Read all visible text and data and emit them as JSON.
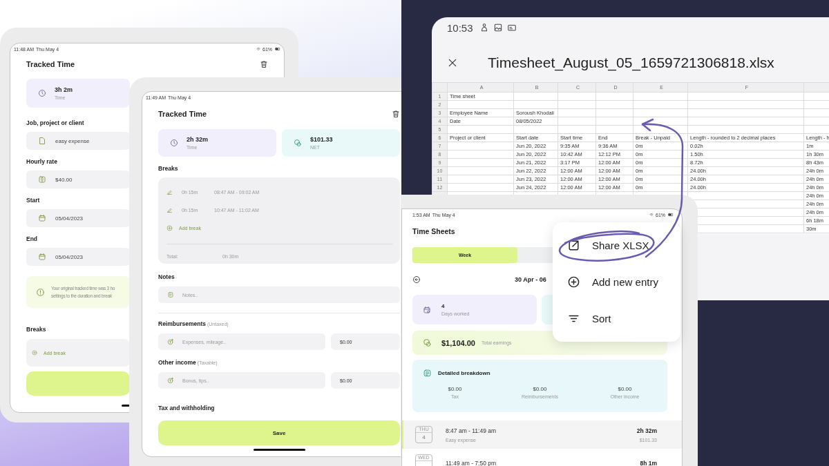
{
  "back_screen": {
    "status": {
      "time": "11:48 AM",
      "date": "Thu May 4",
      "battery": "61%"
    },
    "title": "Tracked Time",
    "time_card": {
      "value": "3h 2m",
      "label": "Time"
    },
    "fields": [
      {
        "label": "Job, project or client",
        "value": "easy expense",
        "kind": "project"
      },
      {
        "label": "Hourly rate",
        "value": "$40.00",
        "kind": "rate"
      },
      {
        "label": "Start",
        "value": "05/04/2023",
        "kind": "date"
      },
      {
        "label": "End",
        "value": "05/04/2023",
        "kind": "date"
      }
    ],
    "notice": [
      "Your original tracked time was 3 ho",
      "settings to the duration and break"
    ],
    "breaks_label": "Breaks",
    "add_break": "Add break"
  },
  "edit_screen": {
    "status": {
      "time": "11:49 AM",
      "date": "Thu May 4"
    },
    "title": "Tracked Time",
    "summary": [
      {
        "value": "2h 32m",
        "label": "Time",
        "kind": "time"
      },
      {
        "value": "$101.33",
        "label": "NET",
        "kind": "money"
      }
    ],
    "breaks_label": "Breaks",
    "breaks": [
      {
        "duration": "0h 15m",
        "range": "08:47 AM - 09:02 AM"
      },
      {
        "duration": "0h 15m",
        "range": "10:47 AM - 11:02 AM"
      }
    ],
    "add_break": "Add break",
    "total_label": "Total:",
    "total_value": "0h 30m",
    "notes_label": "Notes",
    "notes_placeholder": "Notes..",
    "extras": [
      {
        "label": "Reimbursements",
        "note": "(Untaxed)",
        "placeholder": "Expenses, mileage..",
        "amount": "$0.00"
      },
      {
        "label": "Other income",
        "note": "(Taxable)",
        "placeholder": "Bonus, tips..",
        "amount": "$0.00"
      }
    ],
    "tax_label": "Tax and withholding",
    "save": "Save"
  },
  "spreadsheet": {
    "status_time": "10:53",
    "title": "Timesheet_August_05_1659721306818.xlsx",
    "columns": [
      {
        "header": "A"
      },
      {
        "header": "B"
      },
      {
        "header": "C"
      },
      {
        "header": "D"
      },
      {
        "header": "E"
      },
      {
        "header": "F"
      },
      {}
    ],
    "rows": [
      {
        "number": "1",
        "cells": [
          "Time sheet"
        ]
      },
      {
        "number": "2"
      },
      {
        "number": "3",
        "cells": [
          "Employee Name",
          "Soroush Khodaii"
        ]
      },
      {
        "number": "4",
        "cells": [
          "Date",
          "08/05/2022"
        ]
      },
      {
        "number": "5"
      },
      {
        "number": "6",
        "cells": [
          "Project or client",
          "Start date",
          "Start time",
          "End",
          "Break - Unpaid",
          "Length - rounded to 2 decimal places",
          "Length - h"
        ]
      },
      {
        "number": "7",
        "cells": [
          null,
          "Jun 20, 2022",
          "9:35 AM",
          "9:36 AM",
          "0m",
          "0.02h",
          "1m"
        ]
      },
      {
        "number": "8",
        "cells": [
          null,
          "Jun 20, 2022",
          "10:42 AM",
          "12:12 PM",
          "0m",
          "1.50h",
          "1h 30m"
        ]
      },
      {
        "number": "9",
        "cells": [
          null,
          "Jun 21, 2022",
          "3:17 PM",
          "12:00 AM",
          "0m",
          "8.72h",
          "8h 43m"
        ]
      },
      {
        "number": "10",
        "cells": [
          null,
          "Jun 22, 2022",
          "12:00 AM",
          "12:00 AM",
          "0m",
          "24.00h",
          "24h 0m"
        ]
      },
      {
        "number": "11",
        "cells": [
          null,
          "Jun 23, 2022",
          "12:00 AM",
          "12:00 AM",
          "0m",
          "24.00h",
          "24h 0m"
        ]
      },
      {
        "number": "12",
        "cells": [
          null,
          "Jun 24, 2022",
          "12:00 AM",
          "12:00 AM",
          "0m",
          "24.00h",
          "24h 0m"
        ]
      },
      {
        "cells": [
          null,
          null,
          null,
          null,
          null,
          null,
          "24h 0m"
        ]
      },
      {
        "cells": [
          null,
          null,
          null,
          null,
          null,
          null,
          "24h 0m"
        ]
      },
      {
        "cells": [
          null,
          null,
          null,
          null,
          null,
          null,
          "24h 0m"
        ]
      },
      {
        "cells": [
          null,
          null,
          null,
          null,
          null,
          null,
          "6h 18m"
        ]
      },
      {
        "cells": [
          null,
          null,
          null,
          null,
          null,
          null,
          "30m"
        ]
      }
    ]
  },
  "time_sheets": {
    "status": {
      "time": "1:53 AM",
      "date": "Thu May 4",
      "battery": "61%"
    },
    "title": "Time Sheets",
    "segments": [
      {
        "label": "Week",
        "selected": true
      },
      {
        "selected": false
      }
    ],
    "date_range": "30 Apr - 06",
    "stats": [
      {
        "value": "4",
        "label": "Days worked",
        "kind": "days"
      },
      {
        "kind": "other"
      }
    ],
    "earnings": {
      "value": "$1,104.00",
      "label": "Total earnings"
    },
    "breakdown": {
      "title": "Detailed breakdown",
      "items": [
        {
          "value": "$0.00",
          "label": "Tax"
        },
        {
          "value": "$0.00",
          "label": "Reimbursements"
        },
        {
          "value": "$0.00",
          "label": "Other income"
        }
      ]
    },
    "entries": [
      {
        "weekday": "THU",
        "day": "4",
        "range": "8:47 am - 11:49 am",
        "client": "Easy expense",
        "duration": "2h 32m",
        "amount": "$101.33",
        "selected": true
      },
      {
        "weekday": "WED",
        "range": "11:49 am - 7:50 pm",
        "duration": "8h 1m",
        "selected": false
      }
    ],
    "menu": [
      {
        "label": "Share XLSX",
        "kind": "share"
      },
      {
        "label": "Add new entry",
        "kind": "add"
      },
      {
        "label": "Sort",
        "kind": "sort"
      }
    ]
  }
}
